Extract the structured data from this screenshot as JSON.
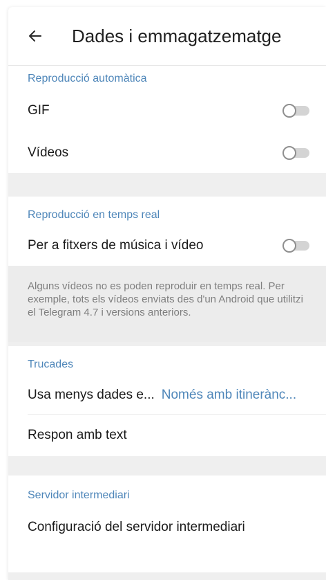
{
  "header": {
    "title": "Dades i emmagatzematge",
    "back_icon": "arrow-left-icon"
  },
  "autoplay": {
    "header": "Reproducció automàtica",
    "gif_label": "GIF",
    "gif_enabled": false,
    "videos_label": "Vídeos",
    "videos_enabled": false
  },
  "streaming": {
    "header": "Reproducció en temps real",
    "music_video_label": "Per a fitxers de música i vídeo",
    "music_video_enabled": false,
    "note": "Alguns vídeos no es poden reproduir en temps real. Per exemple, tots els vídeos enviats des d'un Android que utilitzi el Telegram 4.7 i versions anteriors."
  },
  "calls": {
    "header": "Trucades",
    "less_data_label": "Usa menys dades e...",
    "less_data_value": "Només amb itinerànc...",
    "reply_text_label": "Respon amb text"
  },
  "proxy": {
    "header": "Servidor intermediari",
    "settings_label": "Configuració del servidor intermediari"
  },
  "colors": {
    "accent": "#4e86b9",
    "background": "#efefef"
  }
}
